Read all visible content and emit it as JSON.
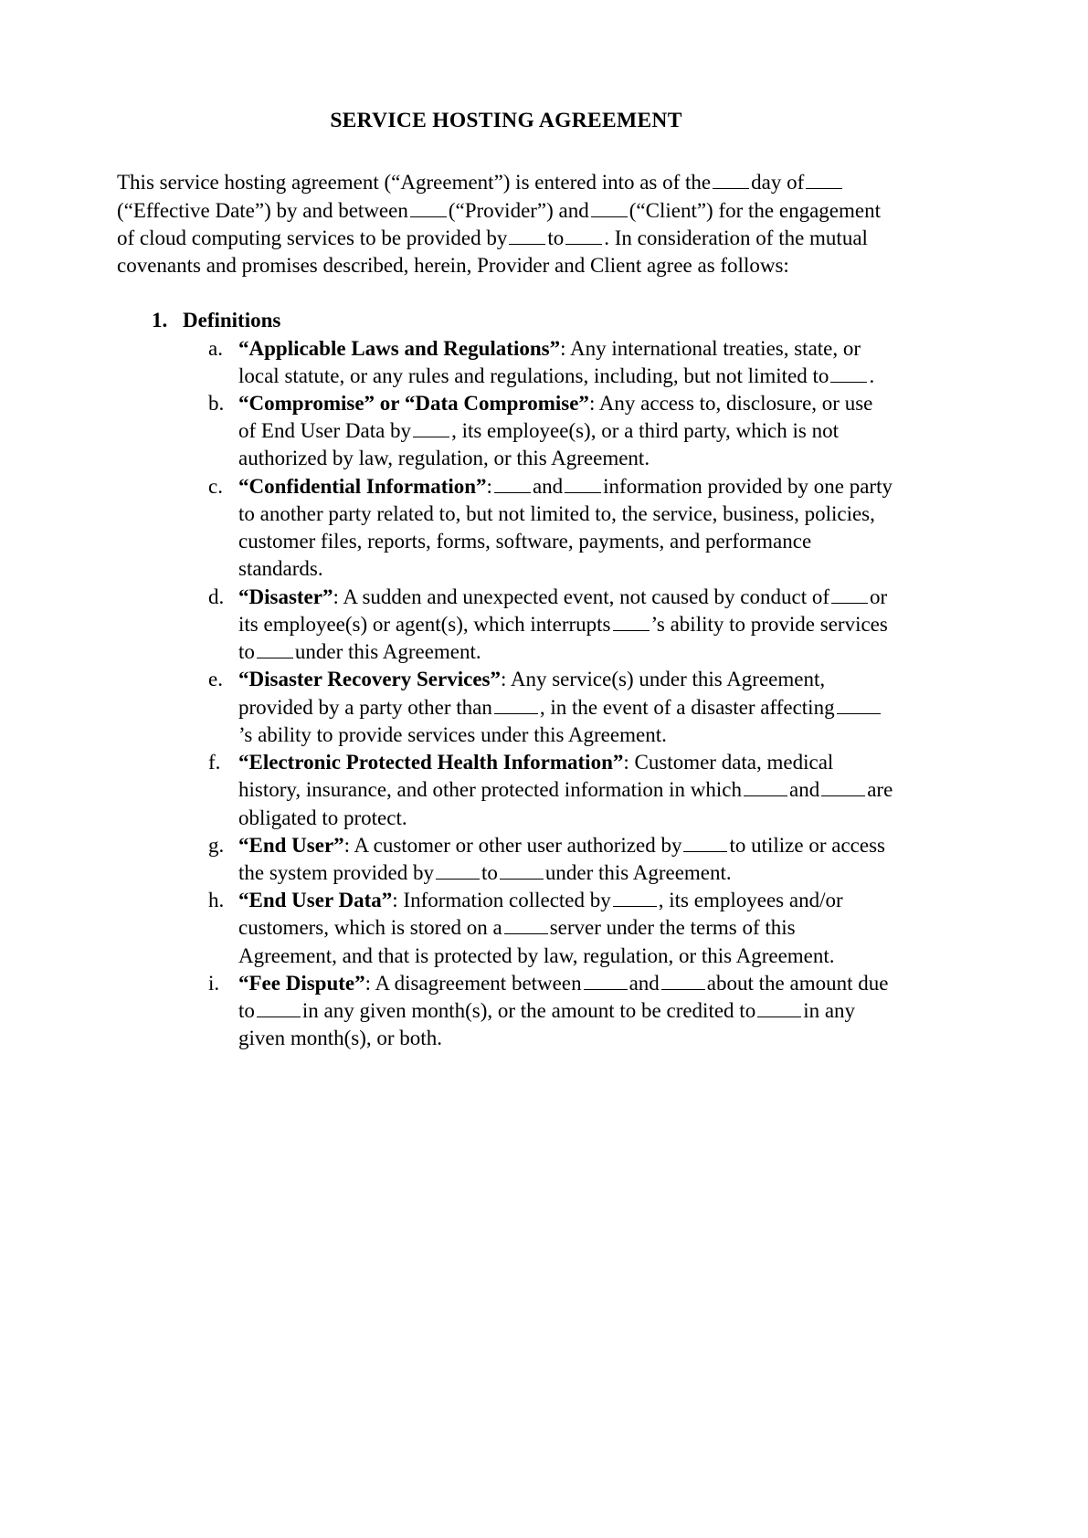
{
  "document": {
    "title": "SERVICE HOSTING AGREEMENT",
    "intro": {
      "p1": "This service hosting agreement (“Agreement”) is entered into as of the",
      "p2": "day of",
      "p3": "(“Effective Date”) by and between",
      "p4": "(“Provider”) and",
      "p5": "(“Client”) for the engagement of cloud computing services to be provided by",
      "p6": "to",
      "p7": ". In consideration of the mutual covenants and promises described, herein, Provider and Client agree as follows:"
    },
    "section": {
      "number": "1.",
      "title": "Definitions"
    },
    "definitions": [
      {
        "marker": "a.",
        "term": "“Applicable Laws and Regulations”",
        "t1": ": Any international treaties, state, or local statute, or any rules and regulations, including, but not limited to",
        "t2": "."
      },
      {
        "marker": "b.",
        "term": "“Compromise” or “Data Compromise”",
        "t1": ": Any access to, disclosure, or use of End User Data by",
        "t2": ", its employee(s), or a third party, which is not authorized by law, regulation, or this Agreement."
      },
      {
        "marker": "c.",
        "term": "“Confidential Information”",
        "t1": ":",
        "t2": "and",
        "t3": "information provided by one party to another party related to, but not limited to, the service, business, policies, customer files, reports, forms, software, payments, and performance standards."
      },
      {
        "marker": "d.",
        "term": "“Disaster”",
        "t1": ": A sudden and unexpected event, not caused by conduct of",
        "t2": "or its employee(s) or agent(s), which interrupts",
        "t3": "’s ability to provide services to",
        "t4": "under this Agreement."
      },
      {
        "marker": "e.",
        "term": "“Disaster Recovery Services”",
        "t1": ": Any service(s) under this Agreement, provided by a party other than",
        "t2": ", in the event of a disaster affecting",
        "t3": "’s ability to provide services under this Agreement."
      },
      {
        "marker": "f.",
        "term": "“Electronic Protected Health Information”",
        "t1": ": Customer data, medical history, insurance, and other protected information in which",
        "t2": "and",
        "t3": "are obligated to protect."
      },
      {
        "marker": "g.",
        "term": "“End User”",
        "t1": ": A customer or other user authorized by",
        "t2": "to utilize or access the system provided by",
        "t3": "to",
        "t4": "under this Agreement."
      },
      {
        "marker": "h.",
        "term": "“End User Data”",
        "t1": ": Information collected by",
        "t2": ", its employees and/or customers, which is stored on a",
        "t3": "server under the terms of this Agreement, and that is protected by law, regulation, or this Agreement."
      },
      {
        "marker": "i.",
        "term": "“Fee Dispute”",
        "t1": ": A disagreement between",
        "t2": "and",
        "t3": "about the amount due to",
        "t4": "in any given month(s), or the amount to be credited to",
        "t5": "in any given month(s), or both."
      }
    ]
  }
}
